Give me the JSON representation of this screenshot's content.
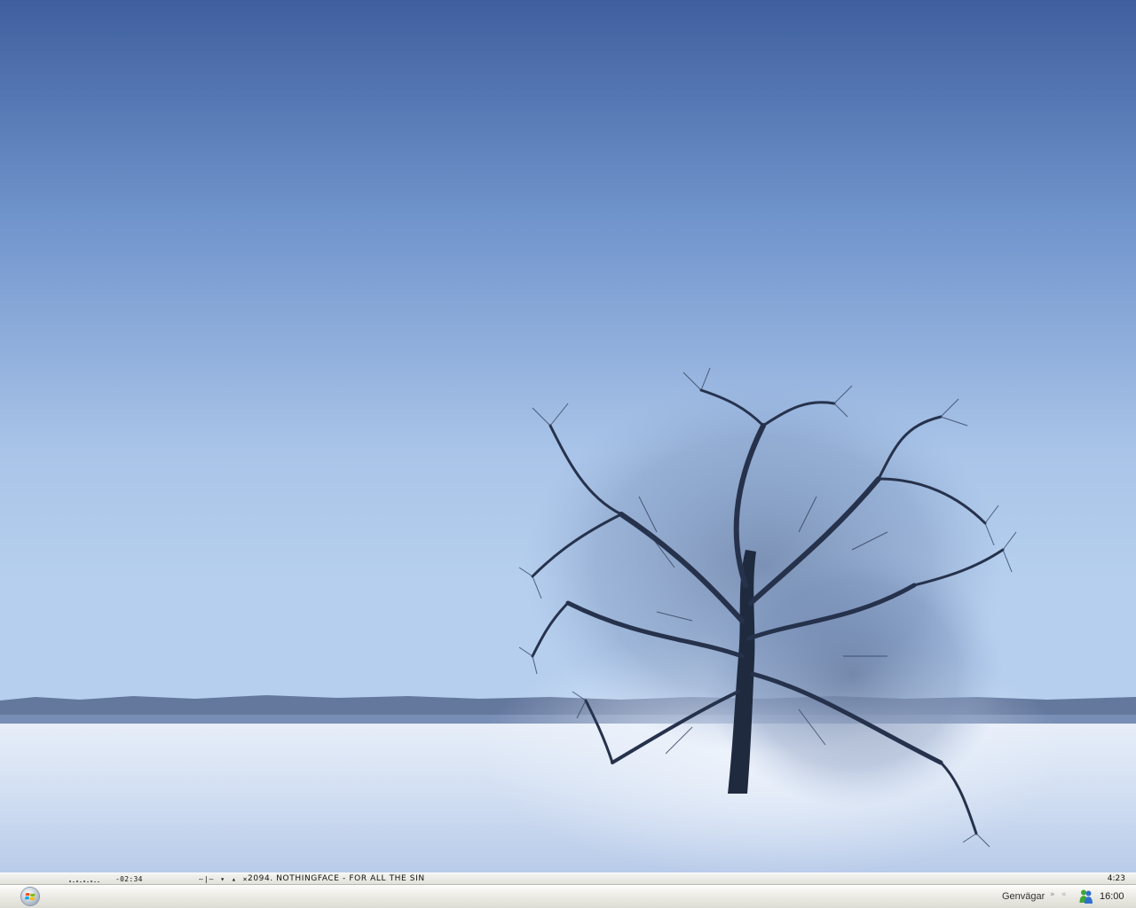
{
  "player": {
    "elapsed_time": "-02:34",
    "controls": [
      "—|—",
      "▾",
      "▴",
      "×"
    ],
    "now_playing": "2094. NOTHINGFACE - FOR ALL THE SIN",
    "track_length": "4:23"
  },
  "taskbar": {
    "quicklaunch_label": "Genvägar",
    "quicklaunch_chevron": "»",
    "tray_collapse": "«",
    "clock": "16:00"
  },
  "icons": {
    "start": "windows-flag-icon",
    "messenger": "msn-messenger-icon"
  },
  "colors": {
    "sky_top": "#3f5f9e",
    "sky_bottom": "#b3cbea",
    "snow": "#dbe6f6",
    "taskbar": "#ecebe6"
  }
}
